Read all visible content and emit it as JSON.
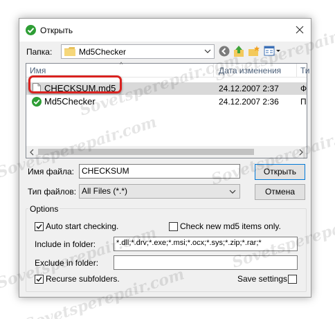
{
  "dialog": {
    "title": "Открыть"
  },
  "folder": {
    "label": "Папка:",
    "value": "Md5Checker"
  },
  "columns": {
    "name": "Имя",
    "date": "Дата изменения",
    "type": "Ти"
  },
  "files": [
    {
      "name": "CHECKSUM.md5",
      "date": "24.12.2007 2:37",
      "type": "Ф"
    },
    {
      "name": "Md5Checker",
      "date": "24.12.2007 2:36",
      "type": "П"
    }
  ],
  "filename": {
    "label": "Имя файла:",
    "value": "CHECKSUM",
    "open_button": "Открыть"
  },
  "filetype": {
    "label": "Тип файлов:",
    "value": "All Files (*.*)",
    "cancel_button": "Отмена"
  },
  "options": {
    "title": "Options",
    "auto_start": {
      "label": "Auto start checking.",
      "checked": true
    },
    "check_new": {
      "label": "Check new md5 items only.",
      "checked": false
    },
    "include_label": "Include in folder:",
    "include_value": "*.dll;*.drv;*.exe;*.msi;*.ocx;*.sys;*.zip;*.rar;*",
    "exclude_label": "Exclude in folder:",
    "exclude_value": "",
    "recurse": {
      "label": "Recurse subfolders.",
      "checked": true
    },
    "save": {
      "label": "Save settings.",
      "checked": false
    }
  },
  "watermark": "Sovetsperepair.com",
  "colors": {
    "highlight": "#d9221f",
    "accent": "#0078d7",
    "check_green": "#2e9e35"
  }
}
